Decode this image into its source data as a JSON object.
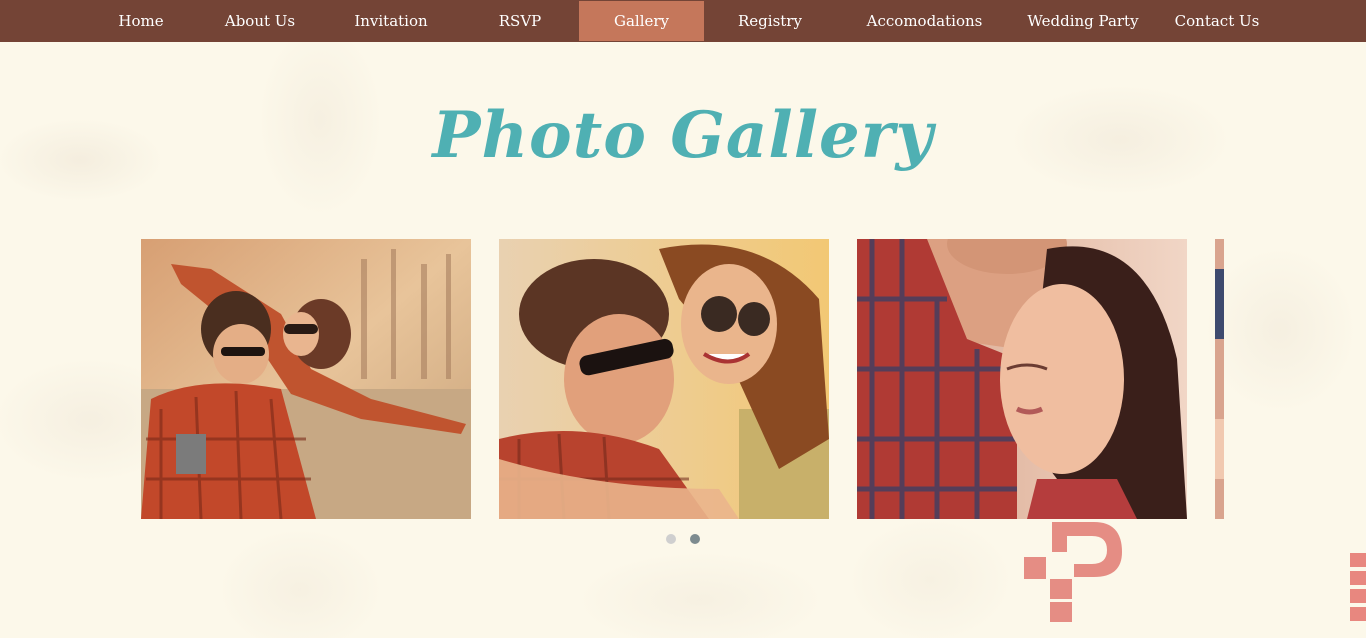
{
  "nav": {
    "items": [
      {
        "label": "Home"
      },
      {
        "label": "About Us"
      },
      {
        "label": "Invitation"
      },
      {
        "label": "RSVP"
      },
      {
        "label": "Gallery"
      },
      {
        "label": "Registry"
      },
      {
        "label": "Accomodations"
      },
      {
        "label": "Wedding Party"
      },
      {
        "label": "Contact Us"
      }
    ],
    "active": "Gallery"
  },
  "gallery": {
    "title": "Photo Gallery",
    "photos": [
      {
        "icon": "couple-piggyback-photo"
      },
      {
        "icon": "couple-hug-sunglasses-photo"
      },
      {
        "icon": "couple-forehead-kiss-photo"
      },
      {
        "icon": "partial-next-photo"
      }
    ],
    "pagination": {
      "page_count": 2,
      "current_page": 2
    }
  },
  "watermark": {
    "logo_icon": "template-logo-icon"
  },
  "colors": {
    "nav_bg": "#744436",
    "nav_active": "#c5775b",
    "title": "#4fb0b3",
    "page_bg": "#fcf8ea",
    "dot_inactive": "#cfcfcf",
    "dot_active": "#7d8b8f",
    "logo": "#e07a72"
  }
}
